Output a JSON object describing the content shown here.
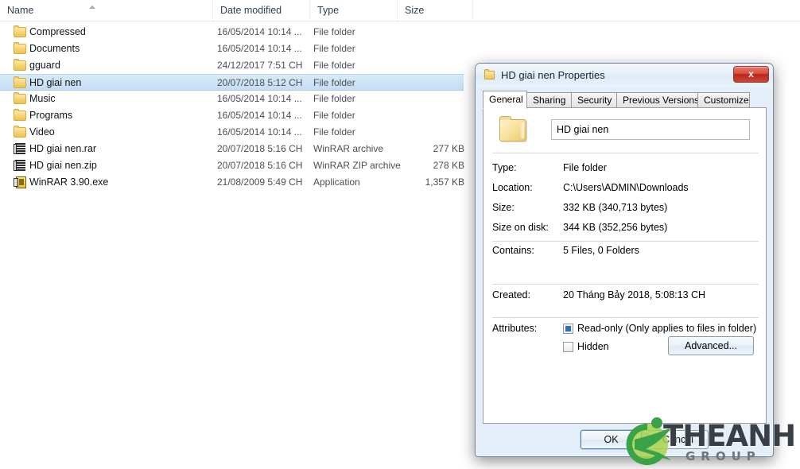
{
  "explorer": {
    "columns": [
      {
        "label": "Name"
      },
      {
        "label": "Date modified"
      },
      {
        "label": "Type"
      },
      {
        "label": "Size"
      }
    ],
    "rows": [
      {
        "icon": "folder-icon",
        "name": "Compressed",
        "date": "16/05/2014 10:14 ...",
        "type": "File folder",
        "size": ""
      },
      {
        "icon": "folder-icon",
        "name": "Documents",
        "date": "16/05/2014 10:14 ...",
        "type": "File folder",
        "size": ""
      },
      {
        "icon": "folder-icon",
        "name": "gguard",
        "date": "24/12/2017 7:51 CH",
        "type": "File folder",
        "size": ""
      },
      {
        "icon": "folder-icon",
        "name": "HD giai nen",
        "date": "20/07/2018 5:12 CH",
        "type": "File folder",
        "size": ""
      },
      {
        "icon": "folder-icon",
        "name": "Music",
        "date": "16/05/2014 10:14 ...",
        "type": "File folder",
        "size": ""
      },
      {
        "icon": "folder-icon",
        "name": "Programs",
        "date": "16/05/2014 10:14 ...",
        "type": "File folder",
        "size": ""
      },
      {
        "icon": "folder-icon",
        "name": "Video",
        "date": "16/05/2014 10:14 ...",
        "type": "File folder",
        "size": ""
      },
      {
        "icon": "archive-icon",
        "name": "HD giai nen.rar",
        "date": "20/07/2018 5:16 CH",
        "type": "WinRAR archive",
        "size": "277 KB"
      },
      {
        "icon": "archive-icon",
        "name": "HD giai nen.zip",
        "date": "20/07/2018 5:16 CH",
        "type": "WinRAR ZIP archive",
        "size": "278 KB"
      },
      {
        "icon": "exe-icon",
        "name": "WinRAR 3.90.exe",
        "date": "21/08/2009 5:49 CH",
        "type": "Application",
        "size": "1,357 KB"
      }
    ],
    "selected_index": 3
  },
  "dialog": {
    "title": "HD giai nen Properties",
    "close_label": "x",
    "tabs": [
      {
        "label": "General",
        "active": true
      },
      {
        "label": "Sharing",
        "active": false
      },
      {
        "label": "Security",
        "active": false
      },
      {
        "label": "Previous Versions",
        "active": false
      },
      {
        "label": "Customize",
        "active": false
      }
    ],
    "name_value": "HD giai nen",
    "properties": [
      {
        "key": "type",
        "label": "Type:",
        "value": "File folder"
      },
      {
        "key": "location",
        "label": "Location:",
        "value": "C:\\Users\\ADMIN\\Downloads"
      },
      {
        "key": "size",
        "label": "Size:",
        "value": "332 KB (340,713 bytes)"
      },
      {
        "key": "sizedisk",
        "label": "Size on disk:",
        "value": "344 KB (352,256 bytes)"
      },
      {
        "key": "contains",
        "label": "Contains:",
        "value": "5 Files, 0 Folders"
      },
      {
        "key": "created",
        "label": "Created:",
        "value": "20 Tháng Bảy 2018, 5:08:13 CH"
      }
    ],
    "attributes": {
      "label": "Attributes:",
      "readonly_label": "Read-only (Only applies to files in folder)",
      "readonly_state": "indeterminate",
      "hidden_label": "Hidden",
      "hidden_state": "unchecked",
      "advanced_label": "Advanced..."
    },
    "buttons": {
      "ok": "OK",
      "cancel": "Cancel"
    },
    "colors": {
      "close_button": "#b8281c",
      "selection": "#cfe3f7",
      "checkbox_fill": "#2a73b8"
    }
  },
  "watermark": {
    "main": "THEANH",
    "sub": "GROUP",
    "colors": {
      "logo_green_dark": "#3aa348",
      "logo_green_light": "#a7d24b"
    }
  }
}
